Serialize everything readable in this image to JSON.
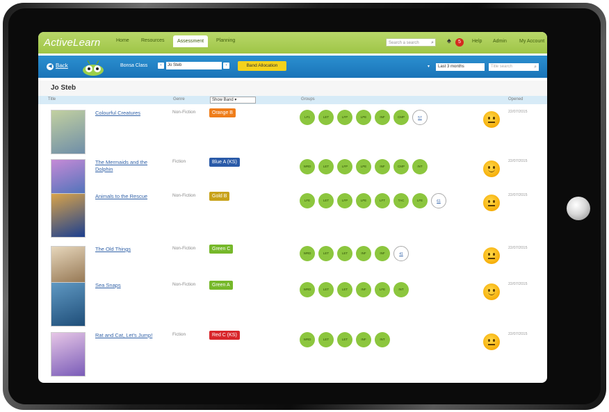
{
  "app": {
    "logo": "ActiveLearn",
    "nav": [
      {
        "label": "Home",
        "active": false
      },
      {
        "label": "Resources",
        "active": false
      },
      {
        "label": "Assessment",
        "active": true
      },
      {
        "label": "Planning",
        "active": false
      }
    ],
    "search_placeholder": "Search a search",
    "notifications_count": "5",
    "top_links": [
      "Help",
      "Admin",
      "My Account"
    ]
  },
  "toolbar": {
    "back_label": "Back",
    "class_label": "Bonsa Class",
    "class_value": "Jo Steb",
    "band_button": "Band Allocation",
    "filter_value": "Last 3 months",
    "title_search_placeholder": "Title search"
  },
  "student_name": "Jo Steb",
  "columns": {
    "title": "Title",
    "genre": "Genre",
    "band_filter": "Show Band",
    "groups": "Groups",
    "opened": "Opened"
  },
  "books": [
    {
      "title": "Colourful Creatures",
      "genre": "Non-Fiction",
      "band": "Orange B",
      "band_color": "#ef7d1a",
      "chips": [
        "LF1",
        "LET",
        "LFP",
        "LPE",
        "INF",
        "CMP"
      ],
      "more": "57",
      "mood": "neutral",
      "opened": "22/07/2015",
      "cover_colors": [
        "#6f8ea8",
        "#c2d0a0"
      ]
    },
    {
      "title": "The Mermaids and the Dolphin",
      "genre": "Fiction",
      "band": "Blue A (KS)",
      "band_color": "#2a5aa8",
      "chips": [
        "WRD",
        "LET",
        "LFP",
        "LPE",
        "INF",
        "CMP",
        "INT"
      ],
      "more": "",
      "mood": "happy",
      "opened": "22/07/2015",
      "cover_colors": [
        "#3a6fb5",
        "#c58ad6"
      ]
    },
    {
      "title": "Animals to the Rescue",
      "genre": "Non-Fiction",
      "band": "Gold B",
      "band_color": "#c8a21a",
      "chips": [
        "LFE",
        "LET",
        "LFP",
        "LPE",
        "LFT",
        "TAC",
        "LFE"
      ],
      "more": "61",
      "mood": "neutral",
      "opened": "22/07/2015",
      "cover_colors": [
        "#1c3f8f",
        "#d8a34a"
      ]
    },
    {
      "title": "The Old Things",
      "genre": "Non-Fiction",
      "band": "Green C",
      "band_color": "#76b82a",
      "chips": [
        "WRD",
        "LET",
        "LET",
        "INF",
        "INF"
      ],
      "more": "41",
      "mood": "neutral",
      "opened": "22/07/2015",
      "cover_colors": [
        "#8a6a45",
        "#e6d6bb"
      ]
    },
    {
      "title": "Sea Snaps",
      "genre": "Non-Fiction",
      "band": "Green A",
      "band_color": "#76b82a",
      "chips": [
        "WRD",
        "LET",
        "LET",
        "INF",
        "LFE",
        "INT"
      ],
      "more": "",
      "mood": "happy",
      "opened": "22/07/2015",
      "cover_colors": [
        "#1f4e79",
        "#5f98c2"
      ]
    },
    {
      "title": "Rat and Cat, Let's Jump!",
      "genre": "Fiction",
      "band": "Red C (KS)",
      "band_color": "#d8262b",
      "chips": [
        "WRD",
        "LET",
        "LET",
        "INF",
        "INT"
      ],
      "more": "",
      "mood": "neutral",
      "opened": "22/07/2015",
      "cover_colors": [
        "#7a5cb8",
        "#e6c6e6"
      ]
    }
  ]
}
